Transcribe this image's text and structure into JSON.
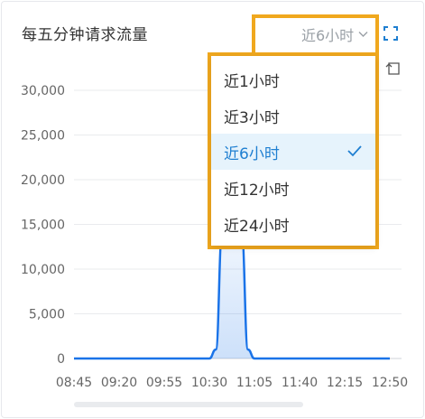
{
  "panel": {
    "title": "每五分钟请求流量"
  },
  "range_select": {
    "value": "近6小时",
    "options": [
      {
        "label": "近1小时",
        "selected": false
      },
      {
        "label": "近3小时",
        "selected": false
      },
      {
        "label": "近6小时",
        "selected": true
      },
      {
        "label": "近12小时",
        "selected": false
      },
      {
        "label": "近24小时",
        "selected": false
      }
    ]
  },
  "icons": {
    "expand": "fullscreen-icon",
    "restore": "restore-icon",
    "check": "check-icon",
    "chevron": "chevron-down-icon"
  },
  "colors": {
    "accent": "#1f7fd1",
    "line": "#1a73e8",
    "highlight": "#f0a81e",
    "selected_bg": "#e6f3fc",
    "grid": "#e9ebee"
  },
  "chart_data": {
    "type": "area",
    "x_labels": [
      "08:45",
      "09:20",
      "09:55",
      "10:30",
      "11:05",
      "11:40",
      "12:15",
      "12:50"
    ],
    "y_ticks": [
      "0",
      "5,000",
      "10,000",
      "15,000",
      "20,000",
      "25,000",
      "30,000"
    ],
    "ylim": [
      0,
      30000
    ],
    "grid": true,
    "series": [
      {
        "x": [
          "08:45",
          "09:20",
          "09:55",
          "10:30",
          "10:35",
          "10:40",
          "10:45",
          "10:50",
          "10:55",
          "11:00",
          "11:05",
          "11:40",
          "12:15",
          "12:50"
        ],
        "values": [
          0,
          0,
          0,
          0,
          1000,
          14000,
          15000,
          15000,
          14000,
          1000,
          0,
          0,
          0,
          0
        ]
      }
    ]
  }
}
